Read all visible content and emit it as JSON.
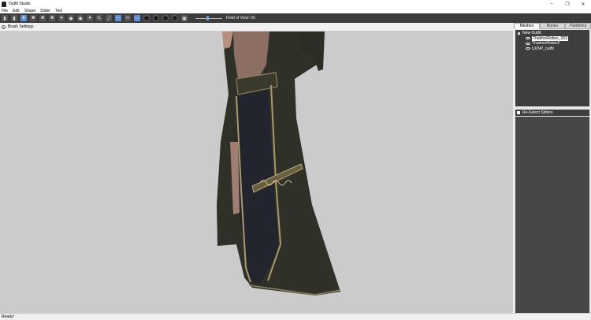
{
  "window": {
    "title": "Outfit Studio",
    "controls": [
      "–",
      "❐",
      "✕"
    ]
  },
  "menu": [
    "File",
    "Edit",
    "Shape",
    "Slider",
    "Tool"
  ],
  "toolbar": {
    "fov_label": "Field of View: 65",
    "fov_value": 65,
    "fov_fraction": 0.45
  },
  "brush_settings": {
    "label": "Brush Settings"
  },
  "panel": {
    "tabs": [
      "Meshes",
      "Bones",
      "Partitions"
    ],
    "active_tab": "Meshes",
    "tree": {
      "root": "New Outfit",
      "children": [
        "ThalmorRobes_003",
        "ThalmorRobesF",
        "UUNP_outfit"
      ],
      "selected": "ThalmorRobes_003"
    },
    "reselect_label": "Re-Select Sliders"
  },
  "status": "Ready!",
  "colors": {
    "toolbar_bg": "#3c3c3c",
    "viewport_bg": "#cbcbcb",
    "panel_bg": "#3e3e3e",
    "accent": "#5c8fd6"
  }
}
